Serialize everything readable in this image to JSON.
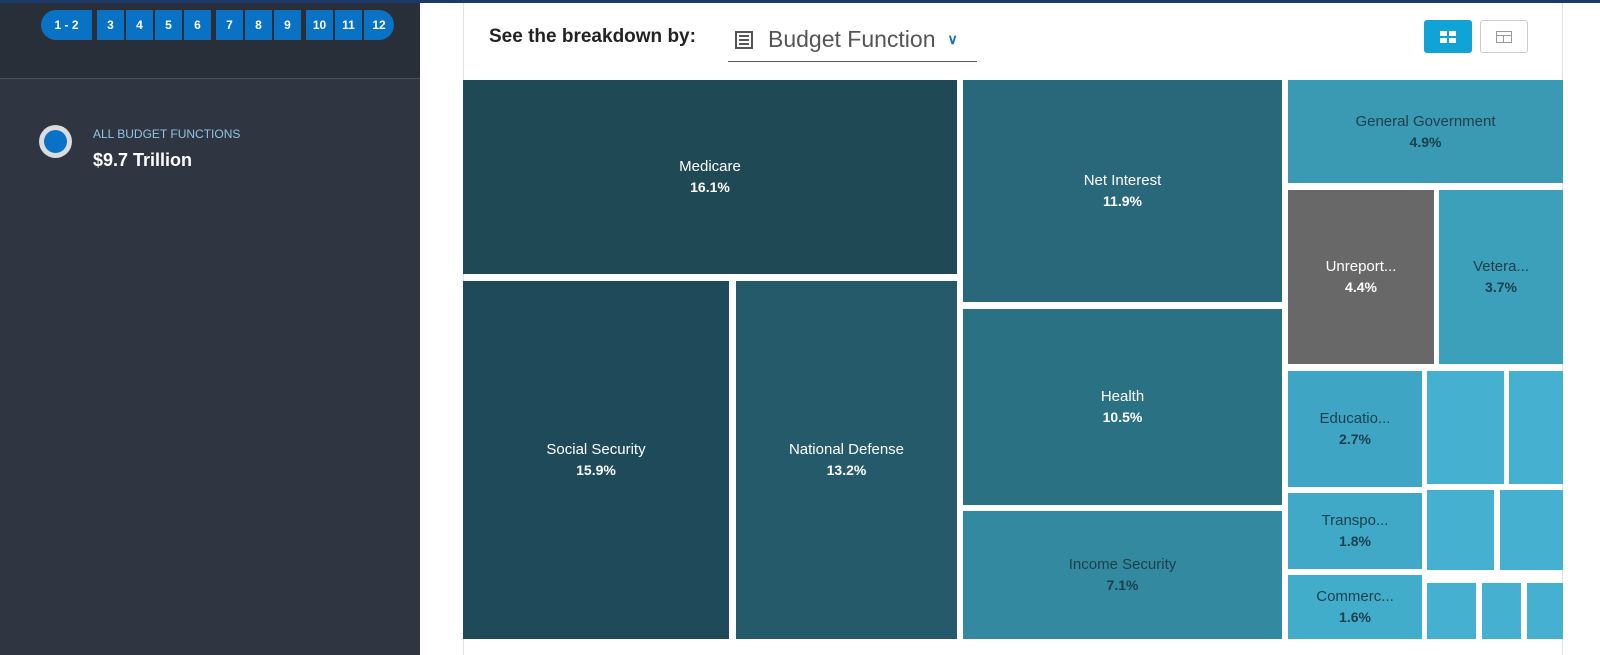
{
  "pager": [
    "1 - 2",
    "3",
    "4",
    "5",
    "6",
    "7",
    "8",
    "9",
    "10",
    "11",
    "12"
  ],
  "sidebar": {
    "all_label": "ALL BUDGET FUNCTIONS",
    "all_value": "$9.7 Trillion"
  },
  "header": {
    "breakdown_label": "See the breakdown by:",
    "dropdown_value": "Budget Function"
  },
  "view_buttons": {
    "active": "treemap-view",
    "inactive": "table-view"
  },
  "colors": {
    "accent": "#0a72c4",
    "unreported": "#686868"
  },
  "chart_data": {
    "type": "treemap",
    "tiles": [
      {
        "label": "Medicare",
        "value": "16.1%"
      },
      {
        "label": "Social Security",
        "value": "15.9%"
      },
      {
        "label": "National Defense",
        "value": "13.2%"
      },
      {
        "label": "Net Interest",
        "value": "11.9%"
      },
      {
        "label": "Health",
        "value": "10.5%"
      },
      {
        "label": "Income Security",
        "value": "7.1%"
      },
      {
        "label": "General Government",
        "value": "4.9%"
      },
      {
        "label": "Unreport...",
        "value": "4.4%"
      },
      {
        "label": "Vetera...",
        "value": "3.7%"
      },
      {
        "label": "Educatio...",
        "value": "2.7%"
      },
      {
        "label": "Transpo...",
        "value": "1.8%"
      },
      {
        "label": "Commerc...",
        "value": "1.6%"
      }
    ],
    "unlabeled_tiles": 7
  }
}
